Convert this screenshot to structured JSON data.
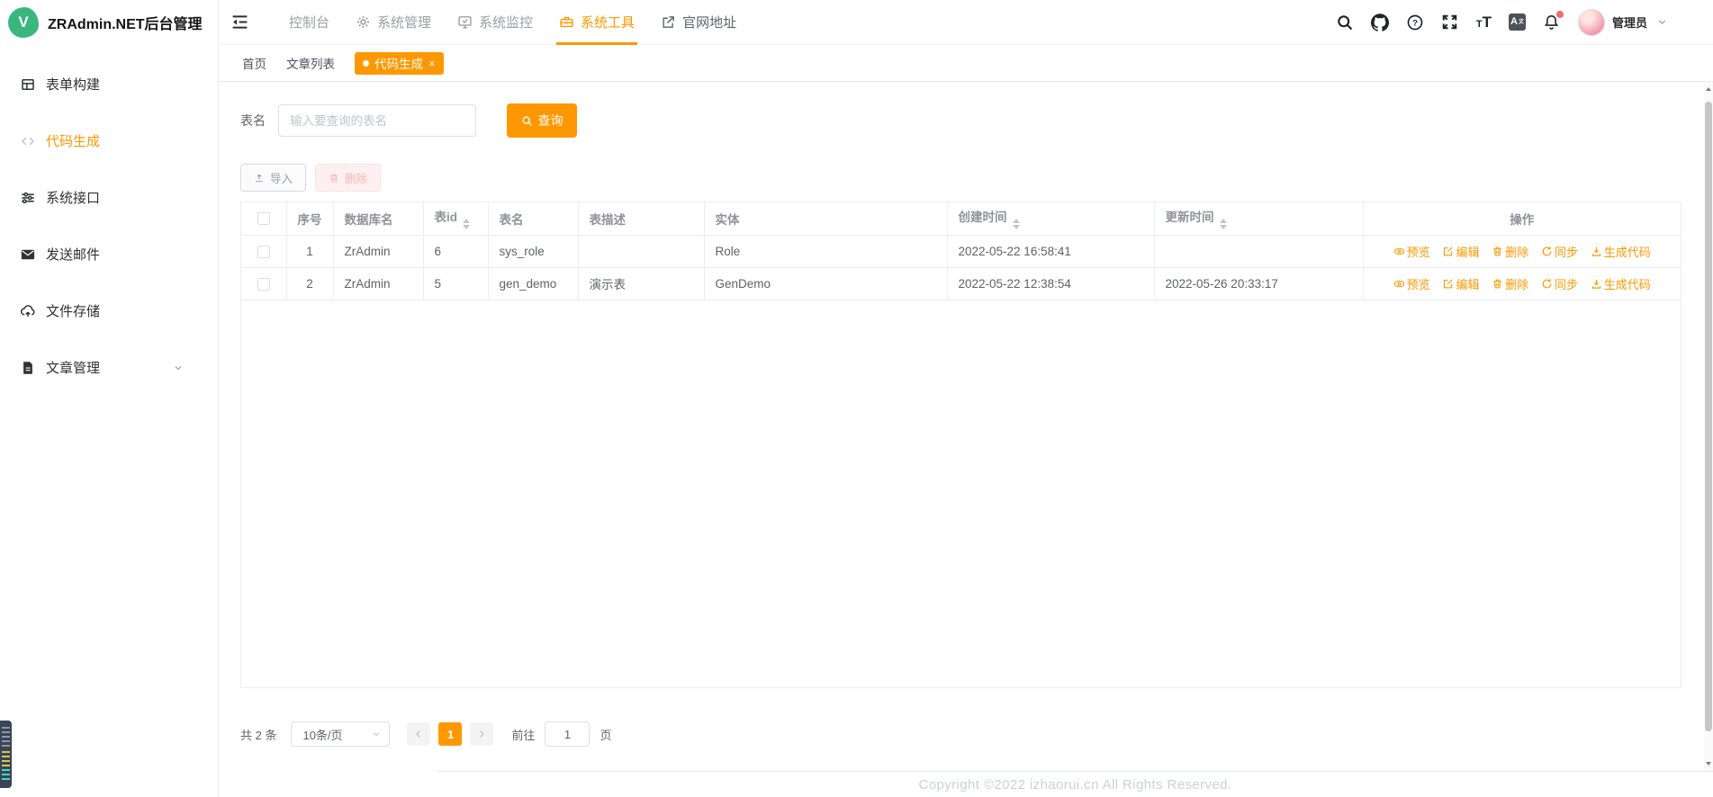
{
  "app": {
    "title": "ZRAdmin.NET后台管理",
    "logo_letter": "V",
    "copyright": "Copyright ©2022 izhaorui.cn All Rights Reserved.",
    "accent_color": "#ff9800",
    "logo_color": "#3ab67f"
  },
  "sidebar": {
    "items": [
      {
        "label": "表单构建",
        "icon": "form-grid-icon"
      },
      {
        "label": "代码生成",
        "icon": "code-icon",
        "active": true
      },
      {
        "label": "系统接口",
        "icon": "sliders-icon"
      },
      {
        "label": "发送邮件",
        "icon": "mail-icon"
      },
      {
        "label": "文件存储",
        "icon": "cloud-upload-icon"
      },
      {
        "label": "文章管理",
        "icon": "document-icon",
        "has_children": true
      }
    ]
  },
  "topnav": {
    "items": [
      {
        "label": "控制台"
      },
      {
        "label": "系统管理",
        "icon": "gear-icon"
      },
      {
        "label": "系统监控",
        "icon": "monitor-icon"
      },
      {
        "label": "系统工具",
        "icon": "toolbox-icon",
        "active": true
      },
      {
        "label": "官网地址",
        "icon": "external-link-icon"
      }
    ],
    "user": {
      "name": "管理员"
    },
    "lang_icon_text": "A",
    "lang_icon_sup": "文",
    "font_icon_small": "T",
    "font_icon_big": "T",
    "help_mark": "?"
  },
  "tabs": [
    {
      "label": "首页"
    },
    {
      "label": "文章列表"
    },
    {
      "label": "代码生成",
      "active": true,
      "close_mark": "×"
    }
  ],
  "search": {
    "field_label": "表名",
    "placeholder": "输入要查询的表名",
    "submit_label": "查询"
  },
  "toolbar": {
    "import_label": "导入",
    "delete_label": "删除"
  },
  "table": {
    "columns": [
      "序号",
      "数据库名",
      "表id",
      "表名",
      "表描述",
      "实体",
      "创建时间",
      "更新时间",
      "操作"
    ],
    "sortable_columns": [
      "表id",
      "创建时间",
      "更新时间"
    ],
    "rows": [
      {
        "index": "1",
        "database": "ZrAdmin",
        "table_id": "6",
        "table_name": "sys_role",
        "description": "",
        "entity": "Role",
        "created_at": "2022-05-22 16:58:41",
        "updated_at": ""
      },
      {
        "index": "2",
        "database": "ZrAdmin",
        "table_id": "5",
        "table_name": "gen_demo",
        "description": "演示表",
        "entity": "GenDemo",
        "created_at": "2022-05-22 12:38:54",
        "updated_at": "2022-05-26 20:33:17"
      }
    ],
    "row_actions": [
      "预览",
      "编辑",
      "删除",
      "同步",
      "生成代码"
    ]
  },
  "pagination": {
    "total": "共 2 条",
    "page_size": "10条/页",
    "current_page": "1",
    "goto_label": "前往",
    "goto_value": "1",
    "unit_label": "页"
  }
}
